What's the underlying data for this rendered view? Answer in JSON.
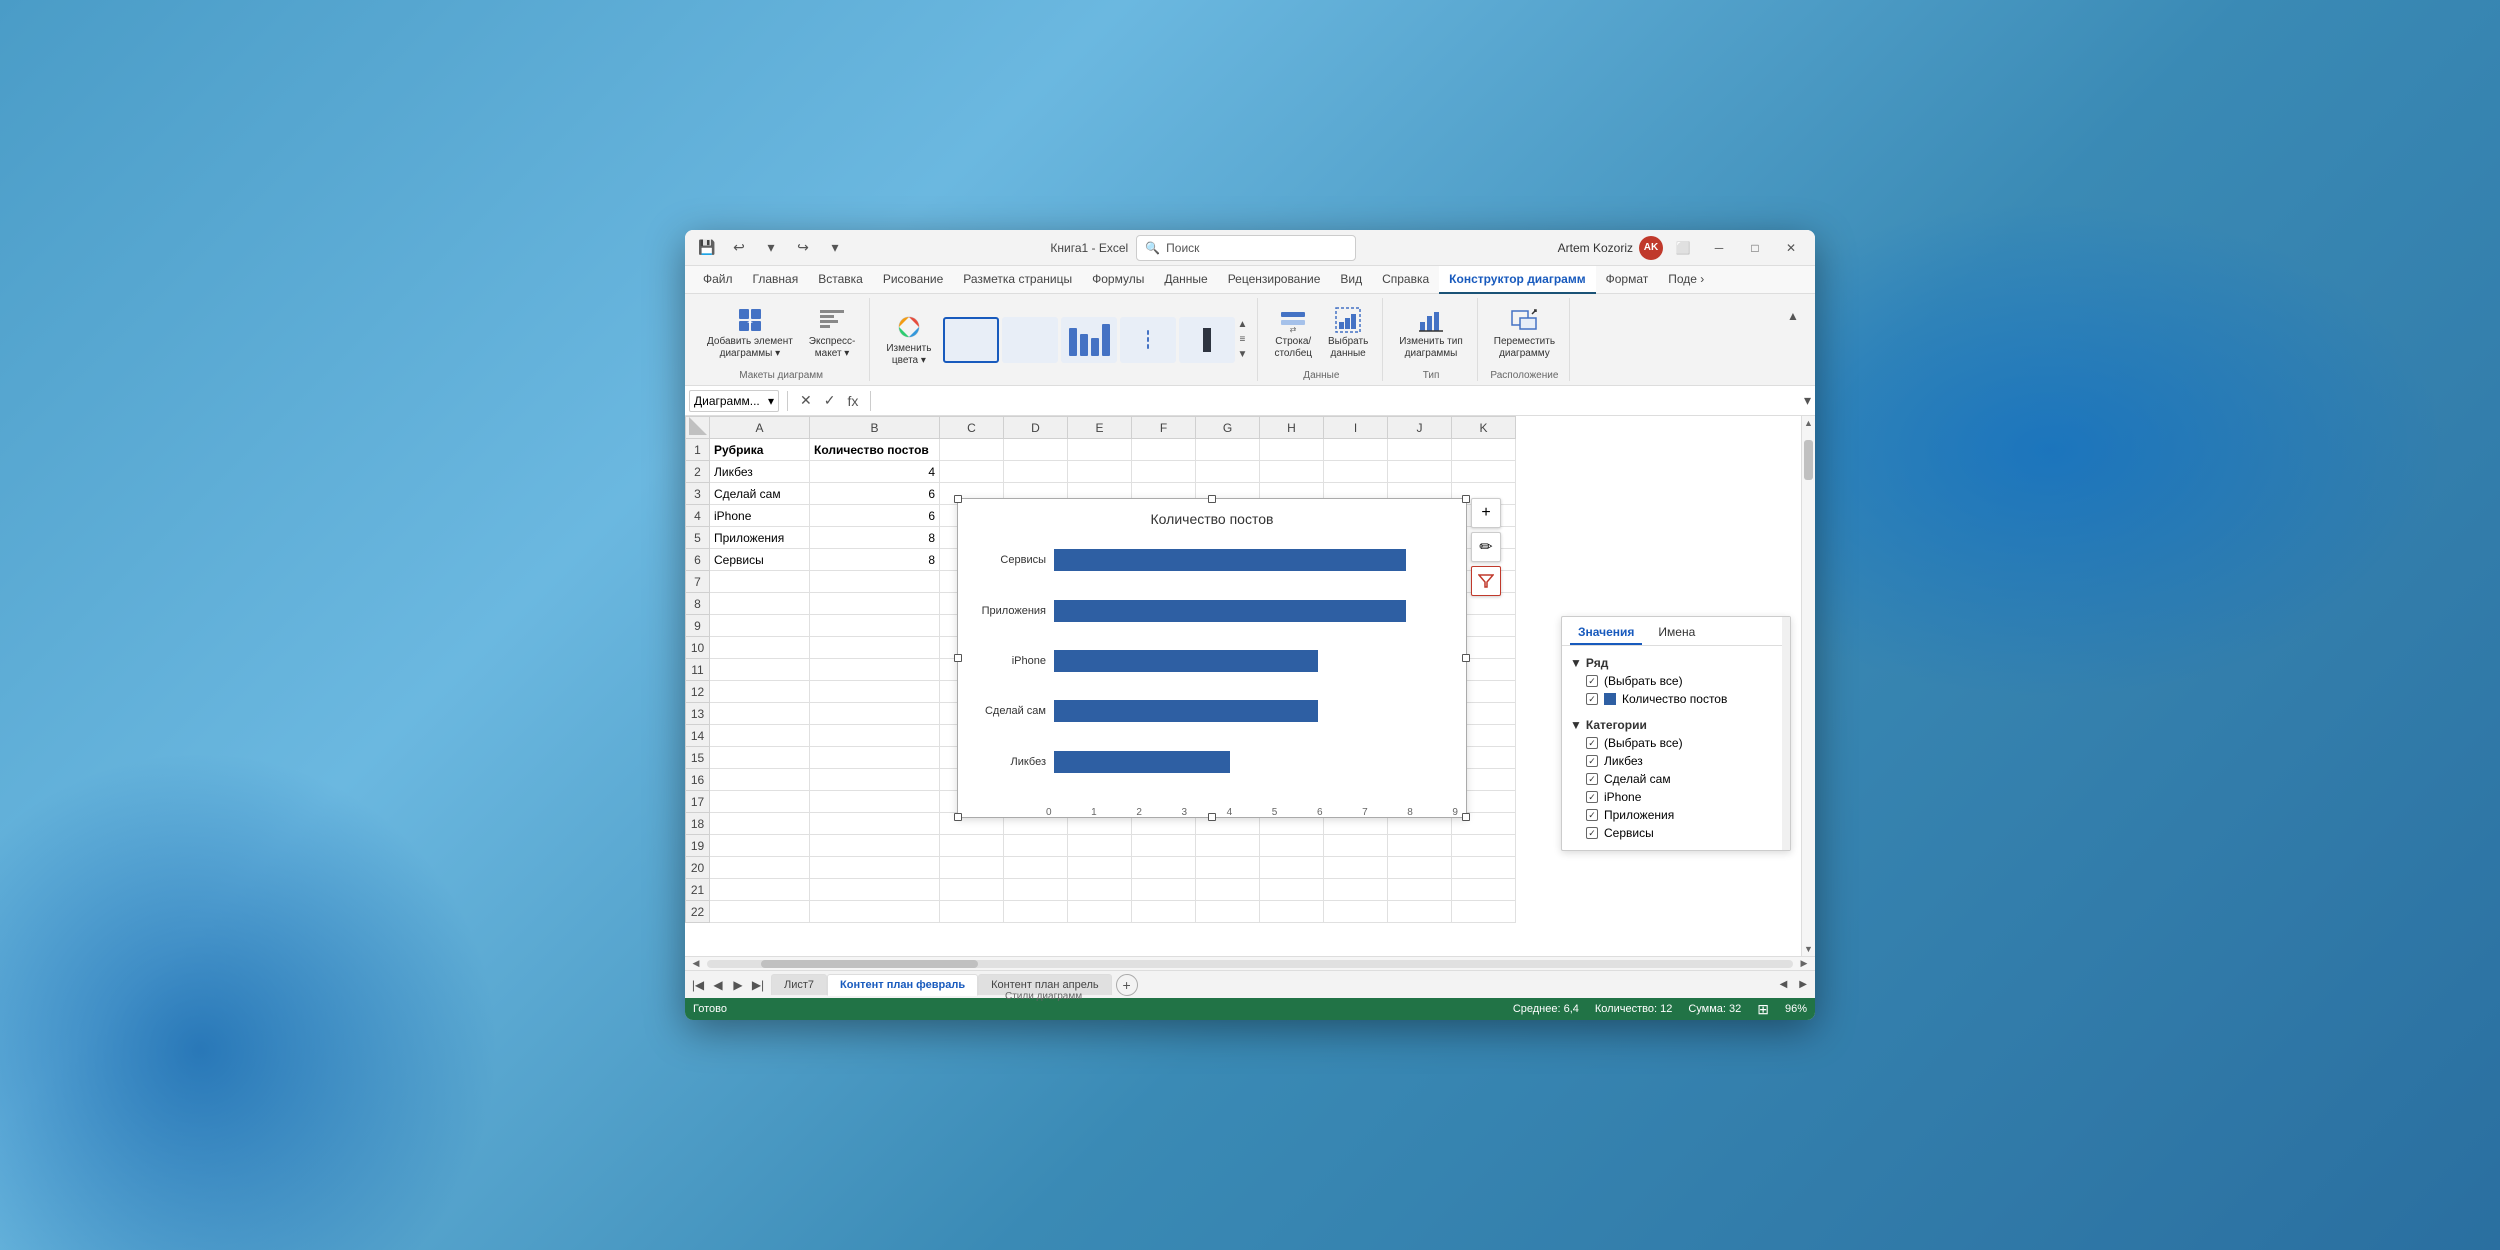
{
  "window": {
    "title": "Книга1 - Excel",
    "search_placeholder": "Поиск",
    "user_name": "Artem Kozoriz",
    "user_initials": "AK"
  },
  "ribbon": {
    "tabs": [
      {
        "id": "file",
        "label": "Файл",
        "active": false
      },
      {
        "id": "home",
        "label": "Главная",
        "active": false
      },
      {
        "id": "insert",
        "label": "Вставка",
        "active": false
      },
      {
        "id": "draw",
        "label": "Рисование",
        "active": false
      },
      {
        "id": "page",
        "label": "Разметка страницы",
        "active": false
      },
      {
        "id": "formulas",
        "label": "Формулы",
        "active": false
      },
      {
        "id": "data",
        "label": "Данные",
        "active": false
      },
      {
        "id": "review",
        "label": "Рецензирование",
        "active": false
      },
      {
        "id": "view",
        "label": "Вид",
        "active": false
      },
      {
        "id": "help",
        "label": "Справка",
        "active": false
      },
      {
        "id": "chart_designer",
        "label": "Конструктор диаграмм",
        "active": true
      },
      {
        "id": "format",
        "label": "Формат",
        "active": false
      },
      {
        "id": "share",
        "label": "Поде",
        "active": false
      }
    ],
    "groups": [
      {
        "id": "chart_layouts",
        "label": "Макеты диаграмм",
        "buttons": [
          {
            "id": "add_element",
            "label": "Добавить элемент\nдиаграммы",
            "icon": "📊"
          },
          {
            "id": "express_layout",
            "label": "Экспресс-\nмакет",
            "icon": "📋"
          }
        ]
      },
      {
        "id": "chart_styles",
        "label": "Стили диаграмм",
        "buttons": [
          {
            "id": "change_colors",
            "label": "Изменить\nцвета",
            "icon": "🎨"
          }
        ]
      },
      {
        "id": "data_group",
        "label": "Данные",
        "buttons": [
          {
            "id": "row_col",
            "label": "Строка/\nстолбец",
            "icon": "⇄"
          },
          {
            "id": "select_data",
            "label": "Выбрать\nданные",
            "icon": "📈"
          }
        ]
      },
      {
        "id": "type_group",
        "label": "Тип",
        "buttons": [
          {
            "id": "change_type",
            "label": "Изменить тип\nдиаграммы",
            "icon": "📊"
          }
        ]
      },
      {
        "id": "location_group",
        "label": "Расположение",
        "buttons": [
          {
            "id": "move_chart",
            "label": "Переместить\nдиаграмму",
            "icon": "↗"
          }
        ]
      }
    ]
  },
  "formula_bar": {
    "name_box": "Диаграмм...",
    "formula_value": ""
  },
  "spreadsheet": {
    "columns": [
      "A",
      "B",
      "C",
      "D",
      "E",
      "F",
      "G",
      "H",
      "I",
      "J",
      "K"
    ],
    "rows": [
      {
        "num": 1,
        "cells": [
          "Рубрика",
          "Количество постов",
          "",
          "",
          "",
          "",
          "",
          "",
          "",
          "",
          ""
        ]
      },
      {
        "num": 2,
        "cells": [
          "Ликбез",
          "4",
          "",
          "",
          "",
          "",
          "",
          "",
          "",
          "",
          ""
        ]
      },
      {
        "num": 3,
        "cells": [
          "Сделай сам",
          "6",
          "",
          "",
          "",
          "",
          "",
          "",
          "",
          "",
          ""
        ]
      },
      {
        "num": 4,
        "cells": [
          "iPhone",
          "6",
          "",
          "",
          "",
          "",
          "",
          "",
          "",
          "",
          ""
        ]
      },
      {
        "num": 5,
        "cells": [
          "Приложения",
          "8",
          "",
          "",
          "",
          "",
          "",
          "",
          "",
          "",
          ""
        ]
      },
      {
        "num": 6,
        "cells": [
          "Сервисы",
          "8",
          "",
          "",
          "",
          "",
          "",
          "",
          "",
          "",
          ""
        ]
      },
      {
        "num": 7,
        "cells": [
          "",
          "",
          "",
          "",
          "",
          "",
          "",
          "",
          "",
          "",
          ""
        ]
      },
      {
        "num": 8,
        "cells": [
          "",
          "",
          "",
          "",
          "",
          "",
          "",
          "",
          "",
          "",
          ""
        ]
      },
      {
        "num": 9,
        "cells": [
          "",
          "",
          "",
          "",
          "",
          "",
          "",
          "",
          "",
          "",
          ""
        ]
      },
      {
        "num": 10,
        "cells": [
          "",
          "",
          "",
          "",
          "",
          "",
          "",
          "",
          "",
          "",
          ""
        ]
      },
      {
        "num": 11,
        "cells": [
          "",
          "",
          "",
          "",
          "",
          "",
          "",
          "",
          "",
          "",
          ""
        ]
      },
      {
        "num": 12,
        "cells": [
          "",
          "",
          "",
          "",
          "",
          "",
          "",
          "",
          "",
          "",
          ""
        ]
      },
      {
        "num": 13,
        "cells": [
          "",
          "",
          "",
          "",
          "",
          "",
          "",
          "",
          "",
          "",
          ""
        ]
      },
      {
        "num": 14,
        "cells": [
          "",
          "",
          "",
          "",
          "",
          "",
          "",
          "",
          "",
          "",
          ""
        ]
      },
      {
        "num": 15,
        "cells": [
          "",
          "",
          "",
          "",
          "",
          "",
          "",
          "",
          "",
          "",
          ""
        ]
      },
      {
        "num": 16,
        "cells": [
          "",
          "",
          "",
          "",
          "",
          "",
          "",
          "",
          "",
          "",
          ""
        ]
      },
      {
        "num": 17,
        "cells": [
          "",
          "",
          "",
          "",
          "",
          "",
          "",
          "",
          "",
          "",
          ""
        ]
      },
      {
        "num": 18,
        "cells": [
          "",
          "",
          "",
          "",
          "",
          "",
          "",
          "",
          "",
          "",
          ""
        ]
      },
      {
        "num": 19,
        "cells": [
          "",
          "",
          "",
          "",
          "",
          "",
          "",
          "",
          "",
          "",
          ""
        ]
      },
      {
        "num": 20,
        "cells": [
          "",
          "",
          "",
          "",
          "",
          "",
          "",
          "",
          "",
          "",
          ""
        ]
      },
      {
        "num": 21,
        "cells": [
          "",
          "",
          "",
          "",
          "",
          "",
          "",
          "",
          "",
          "",
          ""
        ]
      },
      {
        "num": 22,
        "cells": [
          "",
          "",
          "",
          "",
          "",
          "",
          "",
          "",
          "",
          "",
          ""
        ]
      }
    ]
  },
  "chart": {
    "title": "Количество постов",
    "bars": [
      {
        "label": "Сервисы",
        "value": 8,
        "max": 9
      },
      {
        "label": "Приложения",
        "value": 8,
        "max": 9
      },
      {
        "label": "iPhone",
        "value": 6,
        "max": 9
      },
      {
        "label": "Сделай сам",
        "value": 6,
        "max": 9
      },
      {
        "label": "Ликбез",
        "value": 4,
        "max": 9
      }
    ],
    "axis_labels": [
      "0",
      "1",
      "2",
      "3",
      "4",
      "5",
      "6",
      "7",
      "8",
      "9"
    ]
  },
  "filter_panel": {
    "tabs": [
      {
        "label": "Значения",
        "active": true
      },
      {
        "label": "Имена",
        "active": false
      }
    ],
    "series_section": "Ряд",
    "series_items": [
      {
        "label": "(Выбрать все)",
        "checked": true,
        "has_swatch": false
      },
      {
        "label": "Количество постов",
        "checked": true,
        "has_swatch": true
      }
    ],
    "categories_section": "Категории",
    "category_items": [
      {
        "label": "(Выбрать все)",
        "checked": true
      },
      {
        "label": "Ликбез",
        "checked": true
      },
      {
        "label": "Сделай сам",
        "checked": true
      },
      {
        "label": "iPhone",
        "checked": true
      },
      {
        "label": "Приложения",
        "checked": true
      },
      {
        "label": "Сервисы",
        "checked": true
      }
    ]
  },
  "sheet_tabs": [
    {
      "label": "Лист7",
      "active": false
    },
    {
      "label": "Контент план февраль",
      "active": true
    },
    {
      "label": "Контент план апрель",
      "active": false
    }
  ],
  "status_bar": {
    "ready": "Готово",
    "average": "Среднее: 6,4",
    "count": "Количество: 12",
    "sum": "Сумма: 32"
  }
}
